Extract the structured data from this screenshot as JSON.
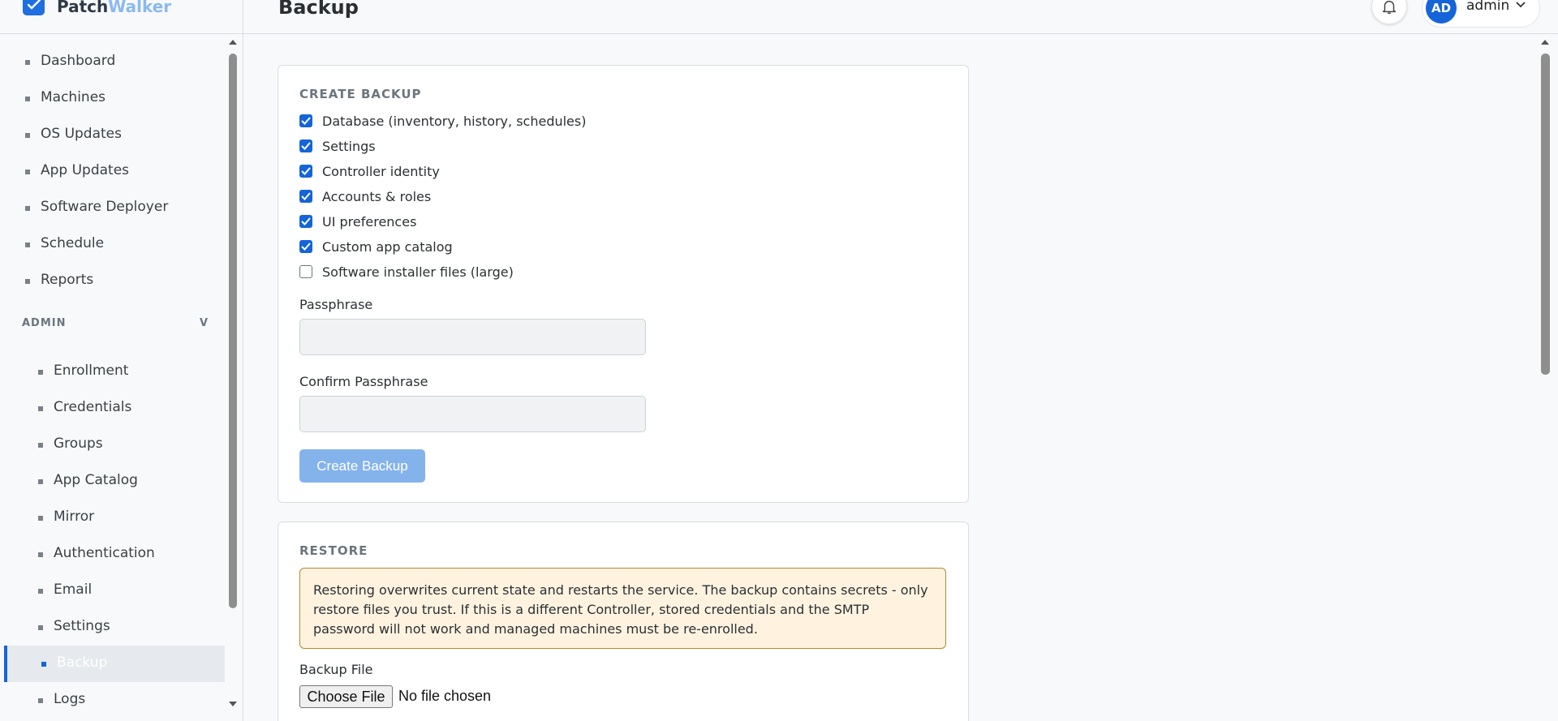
{
  "brand": {
    "name_part1": "Patch",
    "name_part2": "Walker"
  },
  "header": {
    "title": "Backup",
    "user": {
      "initials": "AD",
      "name": "admin"
    }
  },
  "sidebar": {
    "items": [
      {
        "label": "Dashboard"
      },
      {
        "label": "Machines"
      },
      {
        "label": "OS Updates"
      },
      {
        "label": "App Updates"
      },
      {
        "label": "Software Deployer"
      },
      {
        "label": "Schedule"
      },
      {
        "label": "Reports"
      }
    ],
    "admin_section": {
      "title": "ADMIN",
      "toggle": "V",
      "items": [
        {
          "label": "Enrollment"
        },
        {
          "label": "Credentials"
        },
        {
          "label": "Groups"
        },
        {
          "label": "App Catalog"
        },
        {
          "label": "Mirror"
        },
        {
          "label": "Authentication"
        },
        {
          "label": "Email"
        },
        {
          "label": "Settings"
        },
        {
          "label": "Backup",
          "active": true
        },
        {
          "label": "Logs"
        }
      ]
    }
  },
  "create_backup": {
    "title": "CREATE BACKUP",
    "options": [
      {
        "label": "Database (inventory, history, schedules)",
        "checked": true
      },
      {
        "label": "Settings",
        "checked": true
      },
      {
        "label": "Controller identity",
        "checked": true
      },
      {
        "label": "Accounts & roles",
        "checked": true
      },
      {
        "label": "UI preferences",
        "checked": true
      },
      {
        "label": "Custom app catalog",
        "checked": true
      },
      {
        "label": "Software installer files (large)",
        "checked": false
      }
    ],
    "passphrase_label": "Passphrase",
    "passphrase_value": "",
    "confirm_label": "Confirm Passphrase",
    "confirm_value": "",
    "button_label": "Create Backup"
  },
  "restore": {
    "title": "RESTORE",
    "warning": "Restoring overwrites current state and restarts the service. The backup contains secrets - only restore files you trust. If this is a different Controller, stored credentials and the SMTP password will not work and managed machines must be re-enrolled.",
    "file_label": "Backup File",
    "choose_button": "Choose File",
    "file_status": "No file chosen"
  },
  "colors": {
    "accent": "#1565d8",
    "button_disabled": "#84b3ec",
    "warning_bg": "#fff3e0",
    "warning_border": "#b8862d"
  }
}
